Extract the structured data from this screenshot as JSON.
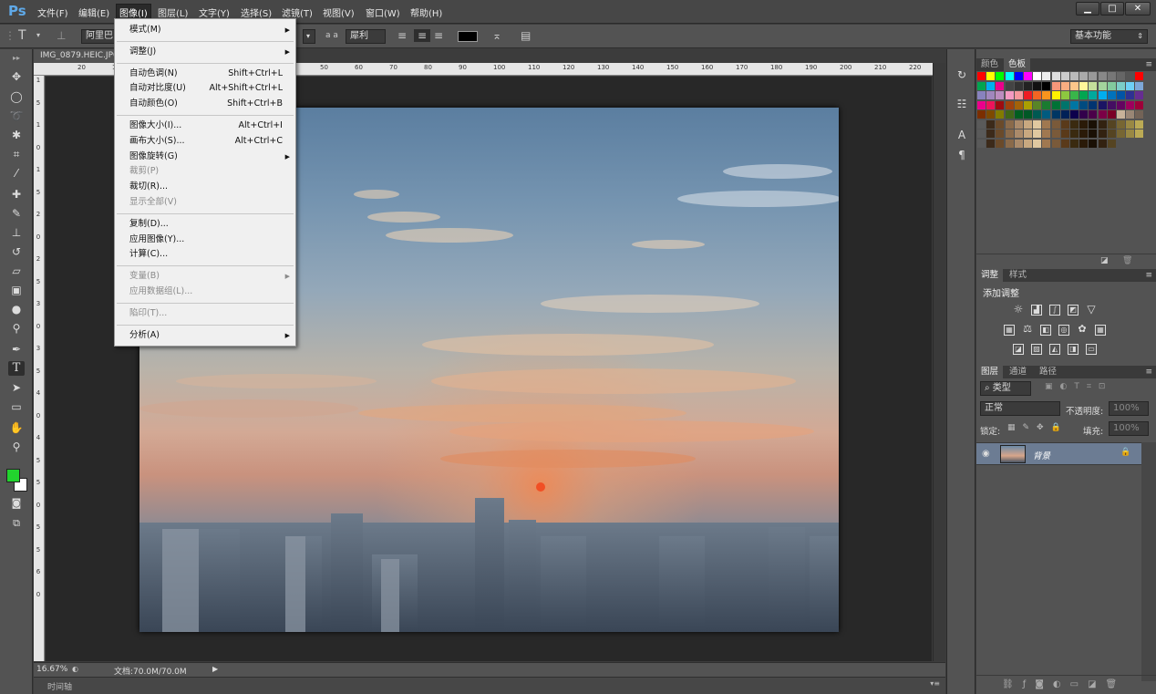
{
  "app": {
    "logo": "Ps"
  },
  "menubar": {
    "items": [
      {
        "label": "文件(F)"
      },
      {
        "label": "编辑(E)"
      },
      {
        "label": "图像(I)"
      },
      {
        "label": "图层(L)"
      },
      {
        "label": "文字(Y)"
      },
      {
        "label": "选择(S)"
      },
      {
        "label": "滤镜(T)"
      },
      {
        "label": "视图(V)"
      },
      {
        "label": "窗口(W)"
      },
      {
        "label": "帮助(H)"
      }
    ],
    "active_index": 2,
    "window_buttons": [
      "▁",
      "□",
      "✕"
    ]
  },
  "options": {
    "tool_icon": "T",
    "font_family": "阿里巴",
    "aa_label": "a a",
    "aa_value": "犀利",
    "color_hex": "#000000",
    "workspace": "基本功能"
  },
  "document": {
    "tab_title": "IMG_0879.HEIC.JPG",
    "ruler_ticks_top": [
      "20",
      "10",
      "",
      "",
      "",
      "",
      "",
      "50",
      "60",
      "70",
      "80",
      "90",
      "100",
      "110",
      "120",
      "130",
      "140",
      "150",
      "160",
      "170",
      "180",
      "190",
      "200",
      "210",
      "220"
    ],
    "ruler_ticks_left": [
      "1",
      "5",
      "1",
      "0",
      "1",
      "5",
      "2",
      "0",
      "2",
      "5",
      "3",
      "0",
      "3",
      "5",
      "4",
      "0",
      "4",
      "5",
      "5",
      "0",
      "5",
      "5",
      "6",
      "0"
    ],
    "zoom": "16.67%",
    "doc_size": "文档:70.0M/70.0M",
    "timeline_label": "时间轴"
  },
  "image_menu": {
    "items": [
      {
        "label": "模式(M)",
        "shortcut": "",
        "submenu": true,
        "disabled": false
      },
      {
        "sep": true
      },
      {
        "label": "调整(J)",
        "shortcut": "",
        "submenu": true,
        "disabled": false
      },
      {
        "sep": true
      },
      {
        "label": "自动色调(N)",
        "shortcut": "Shift+Ctrl+L",
        "submenu": false,
        "disabled": false
      },
      {
        "label": "自动对比度(U)",
        "shortcut": "Alt+Shift+Ctrl+L",
        "submenu": false,
        "disabled": false
      },
      {
        "label": "自动颜色(O)",
        "shortcut": "Shift+Ctrl+B",
        "submenu": false,
        "disabled": false
      },
      {
        "sep": true
      },
      {
        "label": "图像大小(I)...",
        "shortcut": "Alt+Ctrl+I",
        "submenu": false,
        "disabled": false
      },
      {
        "label": "画布大小(S)...",
        "shortcut": "Alt+Ctrl+C",
        "submenu": false,
        "disabled": false
      },
      {
        "label": "图像旋转(G)",
        "shortcut": "",
        "submenu": true,
        "disabled": false
      },
      {
        "label": "裁剪(P)",
        "shortcut": "",
        "submenu": false,
        "disabled": true
      },
      {
        "label": "裁切(R)...",
        "shortcut": "",
        "submenu": false,
        "disabled": false
      },
      {
        "label": "显示全部(V)",
        "shortcut": "",
        "submenu": false,
        "disabled": true
      },
      {
        "sep": true
      },
      {
        "label": "复制(D)...",
        "shortcut": "",
        "submenu": false,
        "disabled": false
      },
      {
        "label": "应用图像(Y)...",
        "shortcut": "",
        "submenu": false,
        "disabled": false
      },
      {
        "label": "计算(C)...",
        "shortcut": "",
        "submenu": false,
        "disabled": false
      },
      {
        "sep": true
      },
      {
        "label": "变量(B)",
        "shortcut": "",
        "submenu": true,
        "disabled": true
      },
      {
        "label": "应用数据组(L)...",
        "shortcut": "",
        "submenu": false,
        "disabled": true
      },
      {
        "sep": true
      },
      {
        "label": "陷印(T)...",
        "shortcut": "",
        "submenu": false,
        "disabled": true
      },
      {
        "sep": true
      },
      {
        "label": "分析(A)",
        "shortcut": "",
        "submenu": true,
        "disabled": false
      }
    ]
  },
  "panels": {
    "color_tabs": [
      "颜色",
      "色板"
    ],
    "adjust_tabs": [
      "调整",
      "样式"
    ],
    "adjust_title": "添加调整",
    "layers_tabs": [
      "图层",
      "通道",
      "路径"
    ],
    "layers_filter": "类型",
    "blend_mode": "正常",
    "opacity_label": "不透明度:",
    "opacity_value": "100%",
    "lock_label": "锁定:",
    "fill_label": "填充:",
    "fill_value": "100%",
    "layer_name": "背景"
  },
  "colors": {
    "foreground": "#22d42e",
    "background": "#ffffff"
  }
}
